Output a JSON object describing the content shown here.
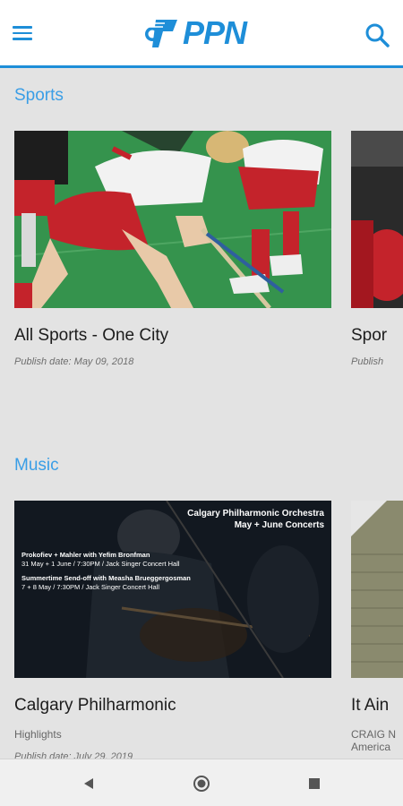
{
  "header": {
    "logo_text": "PPN",
    "menu_icon": "hamburger-menu-icon",
    "search_icon": "search-icon",
    "accent_color": "#1e8ed8"
  },
  "sections": [
    {
      "title": "Sports",
      "cards": [
        {
          "title": "All Sports - One City",
          "subtitle": "",
          "date": "Publish date: May 09, 2018"
        },
        {
          "title": "Spor",
          "subtitle": "",
          "date": "Publish"
        }
      ]
    },
    {
      "title": "Music",
      "cards": [
        {
          "title": "Calgary Philharmonic",
          "subtitle": "Highlights",
          "date": "Publish date: July 29, 2019",
          "poster": {
            "heading": "Calgary Philharmonic Orchestra",
            "subheading": "May + June Concerts",
            "line1_title": "Prokofiev + Mahler with Yefim Bronfman",
            "line1_detail": "31 May + 1 June / 7:30PM / Jack Singer Concert Hall",
            "line2_title": "Summertime Send-off with Measha Brueggergosman",
            "line2_detail": "7 + 8 May / 7:30PM / Jack Singer Concert Hall"
          }
        },
        {
          "title": "It Ain",
          "subtitle_line1": "CRAIG N",
          "subtitle_line2": "America"
        }
      ]
    }
  ],
  "nav": {
    "back_icon": "back-triangle-icon",
    "home_icon": "home-circle-icon",
    "recents_icon": "recents-square-icon"
  }
}
